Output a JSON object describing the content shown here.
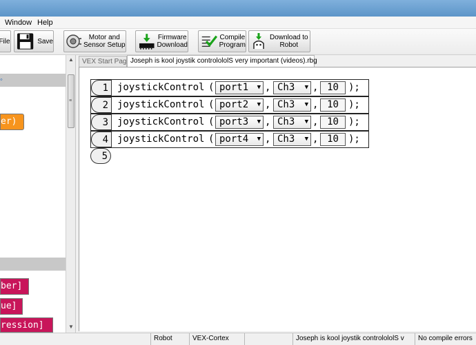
{
  "menu": {
    "items": [
      "Window",
      "Help"
    ]
  },
  "toolbar": {
    "file_label": "File",
    "save_label": "Save",
    "motor_label": "Motor and\nSensor Setup",
    "firmware_label": "Firmware\nDownload",
    "compile_label": "Compile\nProgram",
    "download_label": "Download to\nRobot"
  },
  "left_panel": {
    "top_block": "er)",
    "bottom_blocks": [
      "ber]",
      "ue]",
      "ression]"
    ],
    "colors": {
      "orange": "#f7941d",
      "magenta": "#c8155a"
    }
  },
  "tabs": [
    {
      "label": "VEX Start Page",
      "active": false
    },
    {
      "label": "Joseph is kool  joystik controlololS very important (videos).rbg",
      "active": true
    }
  ],
  "code": {
    "function": "joystickControl",
    "lines": [
      {
        "num": "1",
        "port": "port1",
        "channel": "Ch3",
        "value": "10"
      },
      {
        "num": "2",
        "port": "port2",
        "channel": "Ch3",
        "value": "10"
      },
      {
        "num": "3",
        "port": "port3",
        "channel": "Ch3",
        "value": "10"
      },
      {
        "num": "4",
        "port": "port4",
        "channel": "Ch3",
        "value": "10"
      }
    ],
    "empty_line_num": "5"
  },
  "status": {
    "platform": "Robot",
    "target": "VEX-Cortex",
    "file": "Joseph is kool  joystik controlololS v",
    "compile": "No compile errors"
  }
}
